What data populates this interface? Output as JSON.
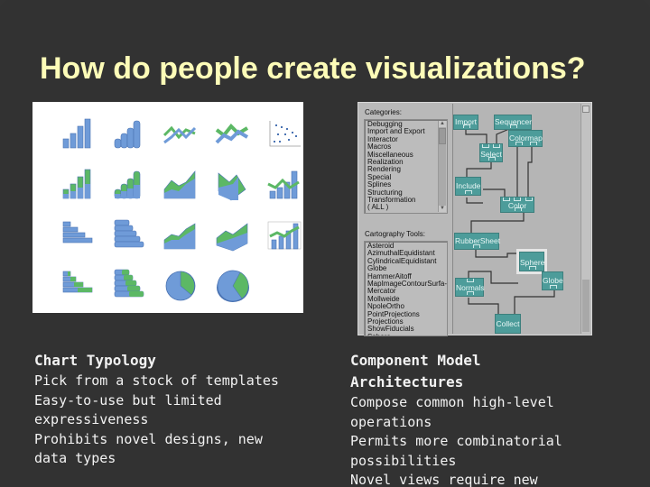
{
  "slide": {
    "title": "How do people create visualizations?",
    "left_column": {
      "heading": "Chart Typology",
      "lines": [
        "Pick from a stock of templates",
        "Easy-to-use but limited",
        "expressiveness",
        "Prohibits novel designs, new",
        "data types"
      ]
    },
    "right_column": {
      "heading_lines": [
        "Component Model",
        "Architectures"
      ],
      "lines": [
        "Compose common high-level",
        "operations",
        "Permits more combinatorial",
        "possibilities",
        "Novel views require new"
      ]
    }
  },
  "chart_gallery": {
    "rows": [
      [
        "column-chart",
        "3d-cone-column-chart",
        "line-chart",
        "3d-line-chart",
        "scatter-chart"
      ],
      [
        "stacked-column-chart",
        "3d-stacked-cone-chart",
        "area-chart",
        "3d-area-chart",
        "combo-column-line-chart"
      ],
      [
        "bar-chart",
        "3d-bar-chart",
        "stacked-area-chart",
        "3d-stacked-area-chart",
        "column-line-chart-with-grid"
      ],
      [
        "stacked-bar-chart",
        "3d-stacked-bar-chart",
        "pie-chart",
        "3d-pie-chart"
      ]
    ],
    "colors": {
      "blue": "#6f9bd8",
      "green": "#5cb865",
      "dark_blue": "#4a73b3"
    }
  },
  "dataflow_panel": {
    "categories_label": "Categories:",
    "categories": [
      "Debugging",
      "Import and Export",
      "Interactor",
      "Macros",
      "Miscellaneous",
      "Realization",
      "Rendering",
      "Special",
      "Splines",
      "Structuring",
      "Transformation",
      "( ALL )"
    ],
    "tools_label": "Cartography Tools:",
    "tools": [
      "Asteroid",
      "AzimuthalEquidistant",
      "CylindricalEquidistant",
      "Globe",
      "HammerAitoff",
      "MapImageContourSurfa-",
      "Mercator",
      "Mollweide",
      "NpoleOrtho",
      "PointProjections",
      "Projections",
      "ShowFiducials",
      "Sphere"
    ],
    "nodes": {
      "import": "Import",
      "sequencer": "Sequencer",
      "select": "Select",
      "colormap": "Colormap",
      "include": "Include",
      "color": "Color",
      "rubbersheet": "RubberSheet",
      "sphere": "Sphere",
      "normals": "Normals",
      "globe": "Globe",
      "collect": "Collect"
    },
    "colors": {
      "node": "#4d9c9a",
      "panel": "#b9b9b9"
    }
  }
}
